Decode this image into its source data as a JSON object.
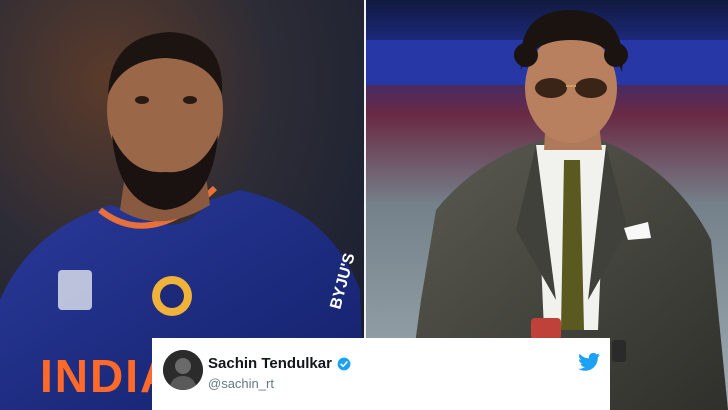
{
  "tweet": {
    "author_name": "Sachin Tendulkar",
    "author_handle": "@sachin_rt",
    "verified": true,
    "accent_color": "#1da1f2"
  },
  "left_photo": {
    "jersey_text": "INDIA",
    "sponsor_text": "BYJU'S"
  },
  "icons": [
    "verified-icon",
    "twitter-bird-icon"
  ]
}
